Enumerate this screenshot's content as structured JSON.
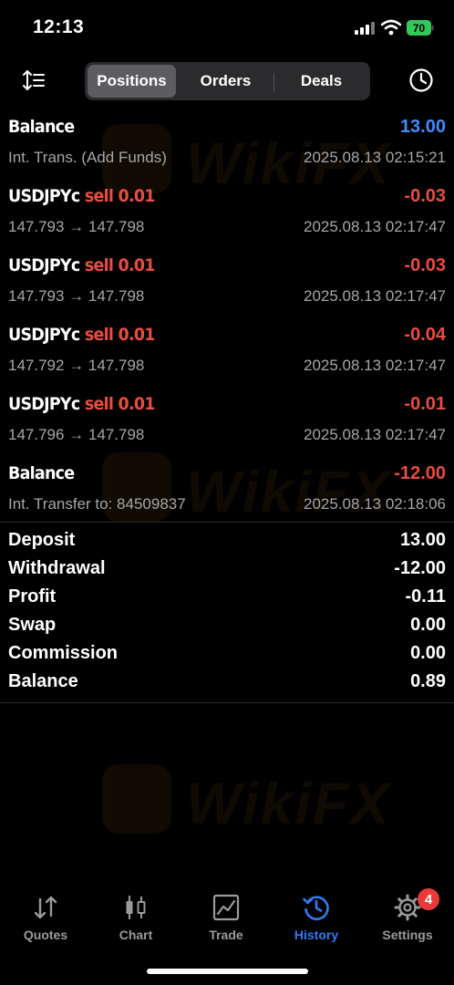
{
  "status_bar": {
    "time": "12:13",
    "battery": "70"
  },
  "toolbar": {
    "tabs": [
      {
        "label": "Positions",
        "active": true
      },
      {
        "label": "Orders",
        "active": false
      },
      {
        "label": "Deals",
        "active": false
      }
    ]
  },
  "history": [
    {
      "title": "Balance",
      "side": "",
      "volume": "",
      "amount": "13.00",
      "amount_color": "#3f8cff",
      "sub": "Int. Trans. (Add Funds)",
      "date": "2025.08.13 02:15:21"
    },
    {
      "title": "USDJPYc",
      "side": "sell",
      "volume": "0.01",
      "amount": "-0.03",
      "amount_color": "#ea4c3f",
      "sub": "147.793 → 147.798",
      "date": "2025.08.13 02:17:47"
    },
    {
      "title": "USDJPYc",
      "side": "sell",
      "volume": "0.01",
      "amount": "-0.03",
      "amount_color": "#ea4c3f",
      "sub": "147.793 → 147.798",
      "date": "2025.08.13 02:17:47"
    },
    {
      "title": "USDJPYc",
      "side": "sell",
      "volume": "0.01",
      "amount": "-0.04",
      "amount_color": "#ea4c3f",
      "sub": "147.792 → 147.798",
      "date": "2025.08.13 02:17:47"
    },
    {
      "title": "USDJPYc",
      "side": "sell",
      "volume": "0.01",
      "amount": "-0.01",
      "amount_color": "#ea4c3f",
      "sub": "147.796 → 147.798",
      "date": "2025.08.13 02:17:47"
    },
    {
      "title": "Balance",
      "side": "",
      "volume": "",
      "amount": "-12.00",
      "amount_color": "#ea4c3f",
      "sub": "Int. Transfer to: 84509837",
      "date": "2025.08.13 02:18:06"
    }
  ],
  "summary": [
    {
      "label": "Deposit",
      "value": "13.00"
    },
    {
      "label": "Withdrawal",
      "value": "-12.00"
    },
    {
      "label": "Profit",
      "value": "-0.11"
    },
    {
      "label": "Swap",
      "value": "0.00"
    },
    {
      "label": "Commission",
      "value": "0.00"
    },
    {
      "label": "Balance",
      "value": "0.89"
    }
  ],
  "watermark": "WikiFX",
  "tabbar": {
    "items": [
      {
        "label": "Quotes",
        "icon": "quotes-arrows-icon"
      },
      {
        "label": "Chart",
        "icon": "candlestick-chart-icon"
      },
      {
        "label": "Trade",
        "icon": "trade-chart-icon"
      },
      {
        "label": "History",
        "icon": "history-clock-icon"
      },
      {
        "label": "Settings",
        "icon": "gear-icon"
      }
    ],
    "active": "History",
    "settings_badge": "4"
  },
  "colors": {
    "accent": "#2f7bf5",
    "negative": "#ea4c3f",
    "positive": "#3f8cff",
    "badge": "#ea3b3b"
  }
}
